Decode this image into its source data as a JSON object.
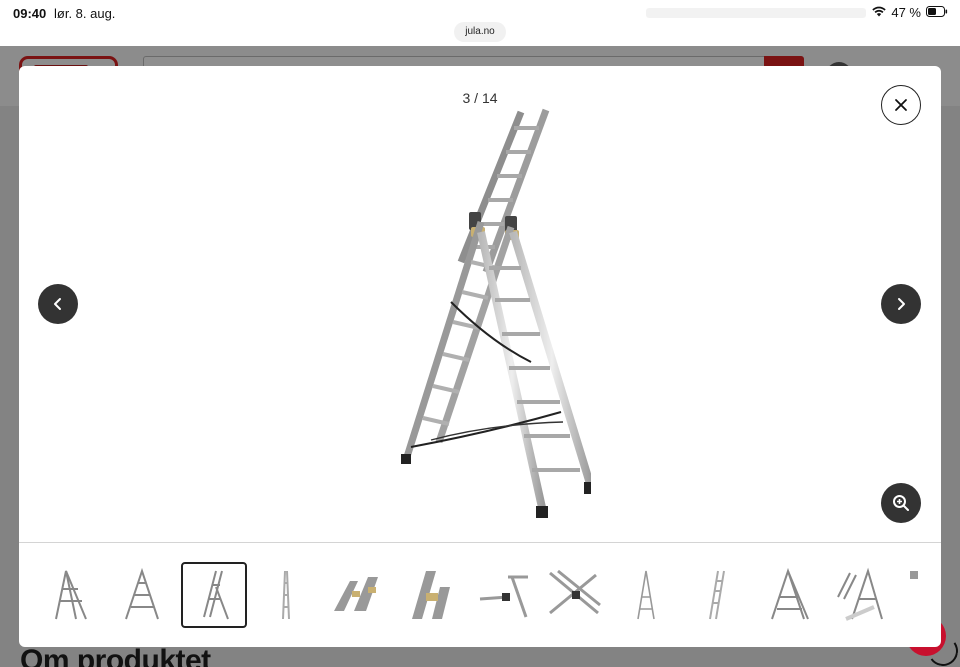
{
  "status_bar": {
    "time": "09:40",
    "date": "lør. 8. aug.",
    "url": "jula.no",
    "battery": "47 %"
  },
  "page": {
    "heading": "Om produktet"
  },
  "gallery": {
    "counter": "3 / 14",
    "current_index": 3,
    "total": 14,
    "thumbnails": [
      {
        "kind": "ladder-a-frame"
      },
      {
        "kind": "ladder-a-frame"
      },
      {
        "kind": "ladder-extended",
        "active": true
      },
      {
        "kind": "ladder-straight"
      },
      {
        "kind": "ladder-detail-hinge"
      },
      {
        "kind": "ladder-detail-lock"
      },
      {
        "kind": "ladder-detail-rope"
      },
      {
        "kind": "ladder-detail-feet"
      },
      {
        "kind": "ladder-a-frame-narrow"
      },
      {
        "kind": "ladder-straight"
      },
      {
        "kind": "ladder-a-frame"
      },
      {
        "kind": "ladder-a-frame-angled"
      },
      {
        "kind": "partial"
      }
    ]
  },
  "colors": {
    "accent": "#c8102e",
    "button_dark": "#333333",
    "overlay": "#7f7f7f"
  },
  "icons": {
    "close": "close-icon",
    "prev": "chevron-left-icon",
    "next": "chevron-right-icon",
    "zoom": "zoom-in-icon"
  }
}
